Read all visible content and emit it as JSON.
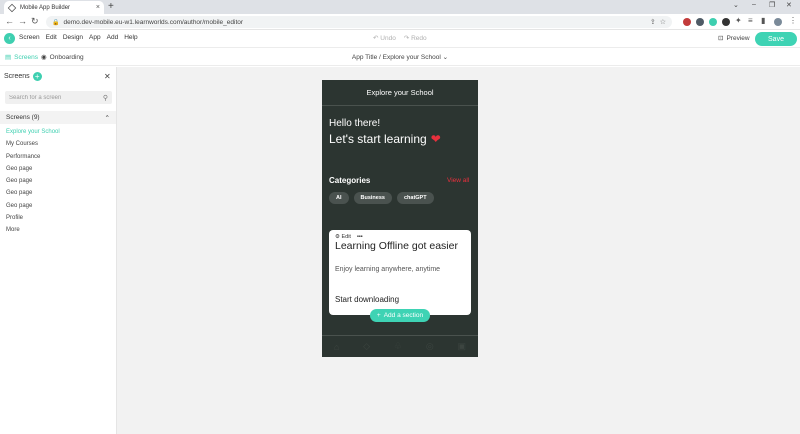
{
  "browser": {
    "tab_title": "Mobile App Builder",
    "tab_close": "×",
    "new_tab": "+",
    "url": "demo.dev-mobile.eu-w1.learnworlds.com/author/mobile_editor",
    "window_controls": [
      "⌄",
      "–",
      "❐",
      "✕"
    ],
    "nav": [
      "←",
      "→",
      "↻"
    ],
    "extension_colors": [
      "#c23b3b",
      "#4f5b66",
      "#3ecfb0",
      "#333333"
    ]
  },
  "header": {
    "menu": [
      "Screen",
      "Edit",
      "Design",
      "App",
      "Add",
      "Help"
    ],
    "undo": "Undo",
    "redo": "Redo",
    "preview": "Preview",
    "save": "Save"
  },
  "subheader": {
    "screens_tab": "Screens",
    "onboarding_tab": "Onboarding",
    "breadcrumb": "App Title / Explore your School"
  },
  "sidebar": {
    "title": "Screens",
    "search_placeholder": "Search for a screen",
    "section_label": "Screens (9)",
    "items": [
      {
        "label": "Explore your School",
        "active": true
      },
      {
        "label": "My Courses"
      },
      {
        "label": "Performance"
      },
      {
        "label": "Geo page"
      },
      {
        "label": "Geo page"
      },
      {
        "label": "Geo page"
      },
      {
        "label": "Geo page"
      },
      {
        "label": "Profile"
      },
      {
        "label": "More"
      }
    ]
  },
  "phone": {
    "title": "Explore your School",
    "greeting_1": "Hello there!",
    "greeting_2": "Let's start learning",
    "categories_title": "Categories",
    "view_all": "View all",
    "chips": [
      "AI",
      "Business",
      "chatGPT"
    ],
    "card": {
      "edit": "Edit",
      "more": "•••",
      "title": "Learning Offline got easier",
      "subtitle": "Enjoy learning anywhere, anytime",
      "cta": "Start downloading"
    },
    "add_section": "Add a section"
  },
  "colors": {
    "accent": "#3ecfb0",
    "phone_bg": "#2c3531",
    "highlight_red": "#e8303d",
    "canvas_bg": "#f2f2f2"
  }
}
